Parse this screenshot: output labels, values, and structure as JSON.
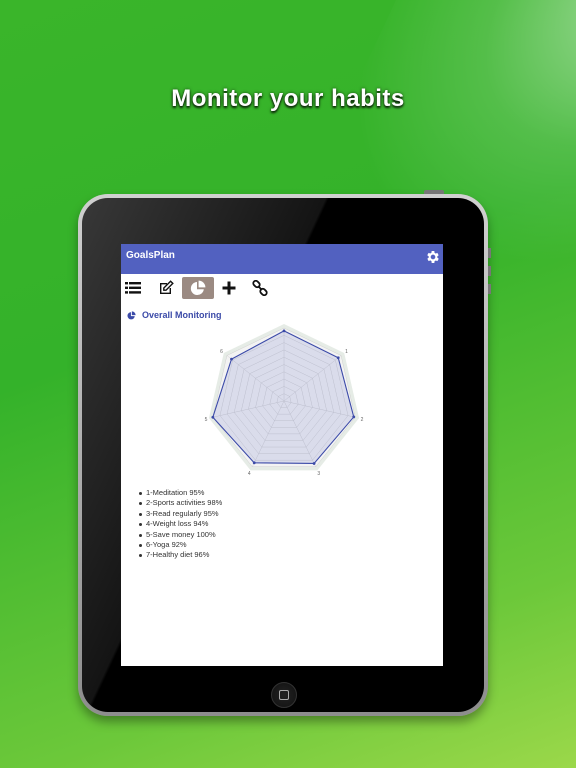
{
  "promo": {
    "headline": "Monitor your habits"
  },
  "app": {
    "title": "GoalsPlan",
    "toolbar": [
      {
        "icon": "list-icon",
        "active": false
      },
      {
        "icon": "edit-icon",
        "active": false
      },
      {
        "icon": "pie-chart-icon",
        "active": true
      },
      {
        "icon": "plus-icon",
        "active": false
      },
      {
        "icon": "link-icon",
        "active": false
      }
    ],
    "section_title": "Overall Monitoring",
    "accent_color": "#5261c0",
    "active_tab_color": "#9b8a82"
  },
  "chart_data": {
    "type": "radar",
    "axes": [
      "7",
      "1",
      "2",
      "3",
      "4",
      "5",
      "6"
    ],
    "series": [
      {
        "values": [
          96,
          95,
          98,
          95,
          94,
          100,
          92
        ]
      }
    ],
    "range": [
      0,
      100
    ],
    "rings": 10,
    "legend": [
      "1-Meditation 95%",
      "2-Sports activities 98%",
      "3-Read regularly 95%",
      "4-Weight loss 94%",
      "5-Save money 100%",
      "6-Yoga 92%",
      "7-Healthy diet 96%"
    ]
  }
}
